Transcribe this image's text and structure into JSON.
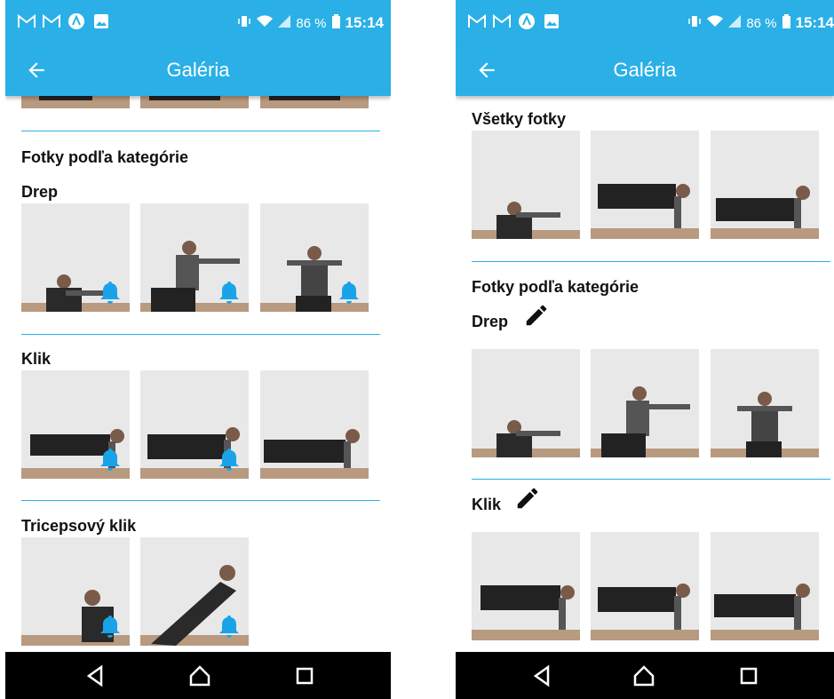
{
  "colors": {
    "accent": "#2ab0e6",
    "divider": "#2ab0e6",
    "bell": "#1aa3e8",
    "nav": "#000000"
  },
  "status_bar": {
    "battery": "86 %",
    "time": "15:14",
    "icons": [
      "gmail-icon",
      "gmail-icon",
      "app-icon",
      "image-icon"
    ]
  },
  "app_bar": {
    "title": "Galéria",
    "back_icon": "arrow-left-icon"
  },
  "left_screen": {
    "section_title": "Fotky podľa kategórie",
    "categories": [
      {
        "name": "Drep",
        "photos": 3,
        "bell": true
      },
      {
        "name": "Klik",
        "photos": 3,
        "bell": true
      },
      {
        "name": "Tricepsový klik",
        "photos": 2,
        "bell": true
      }
    ]
  },
  "right_screen": {
    "all_photos_title": "Všetky fotky",
    "section_title": "Fotky podľa kategórie",
    "categories": [
      {
        "name": "Drep",
        "edit_icon": "pencil-icon",
        "photos": 3
      },
      {
        "name": "Klik",
        "edit_icon": "pencil-icon",
        "photos": 3
      }
    ]
  },
  "nav_bar": {
    "buttons": [
      "back-triangle-icon",
      "home-icon",
      "recents-square-icon"
    ]
  }
}
